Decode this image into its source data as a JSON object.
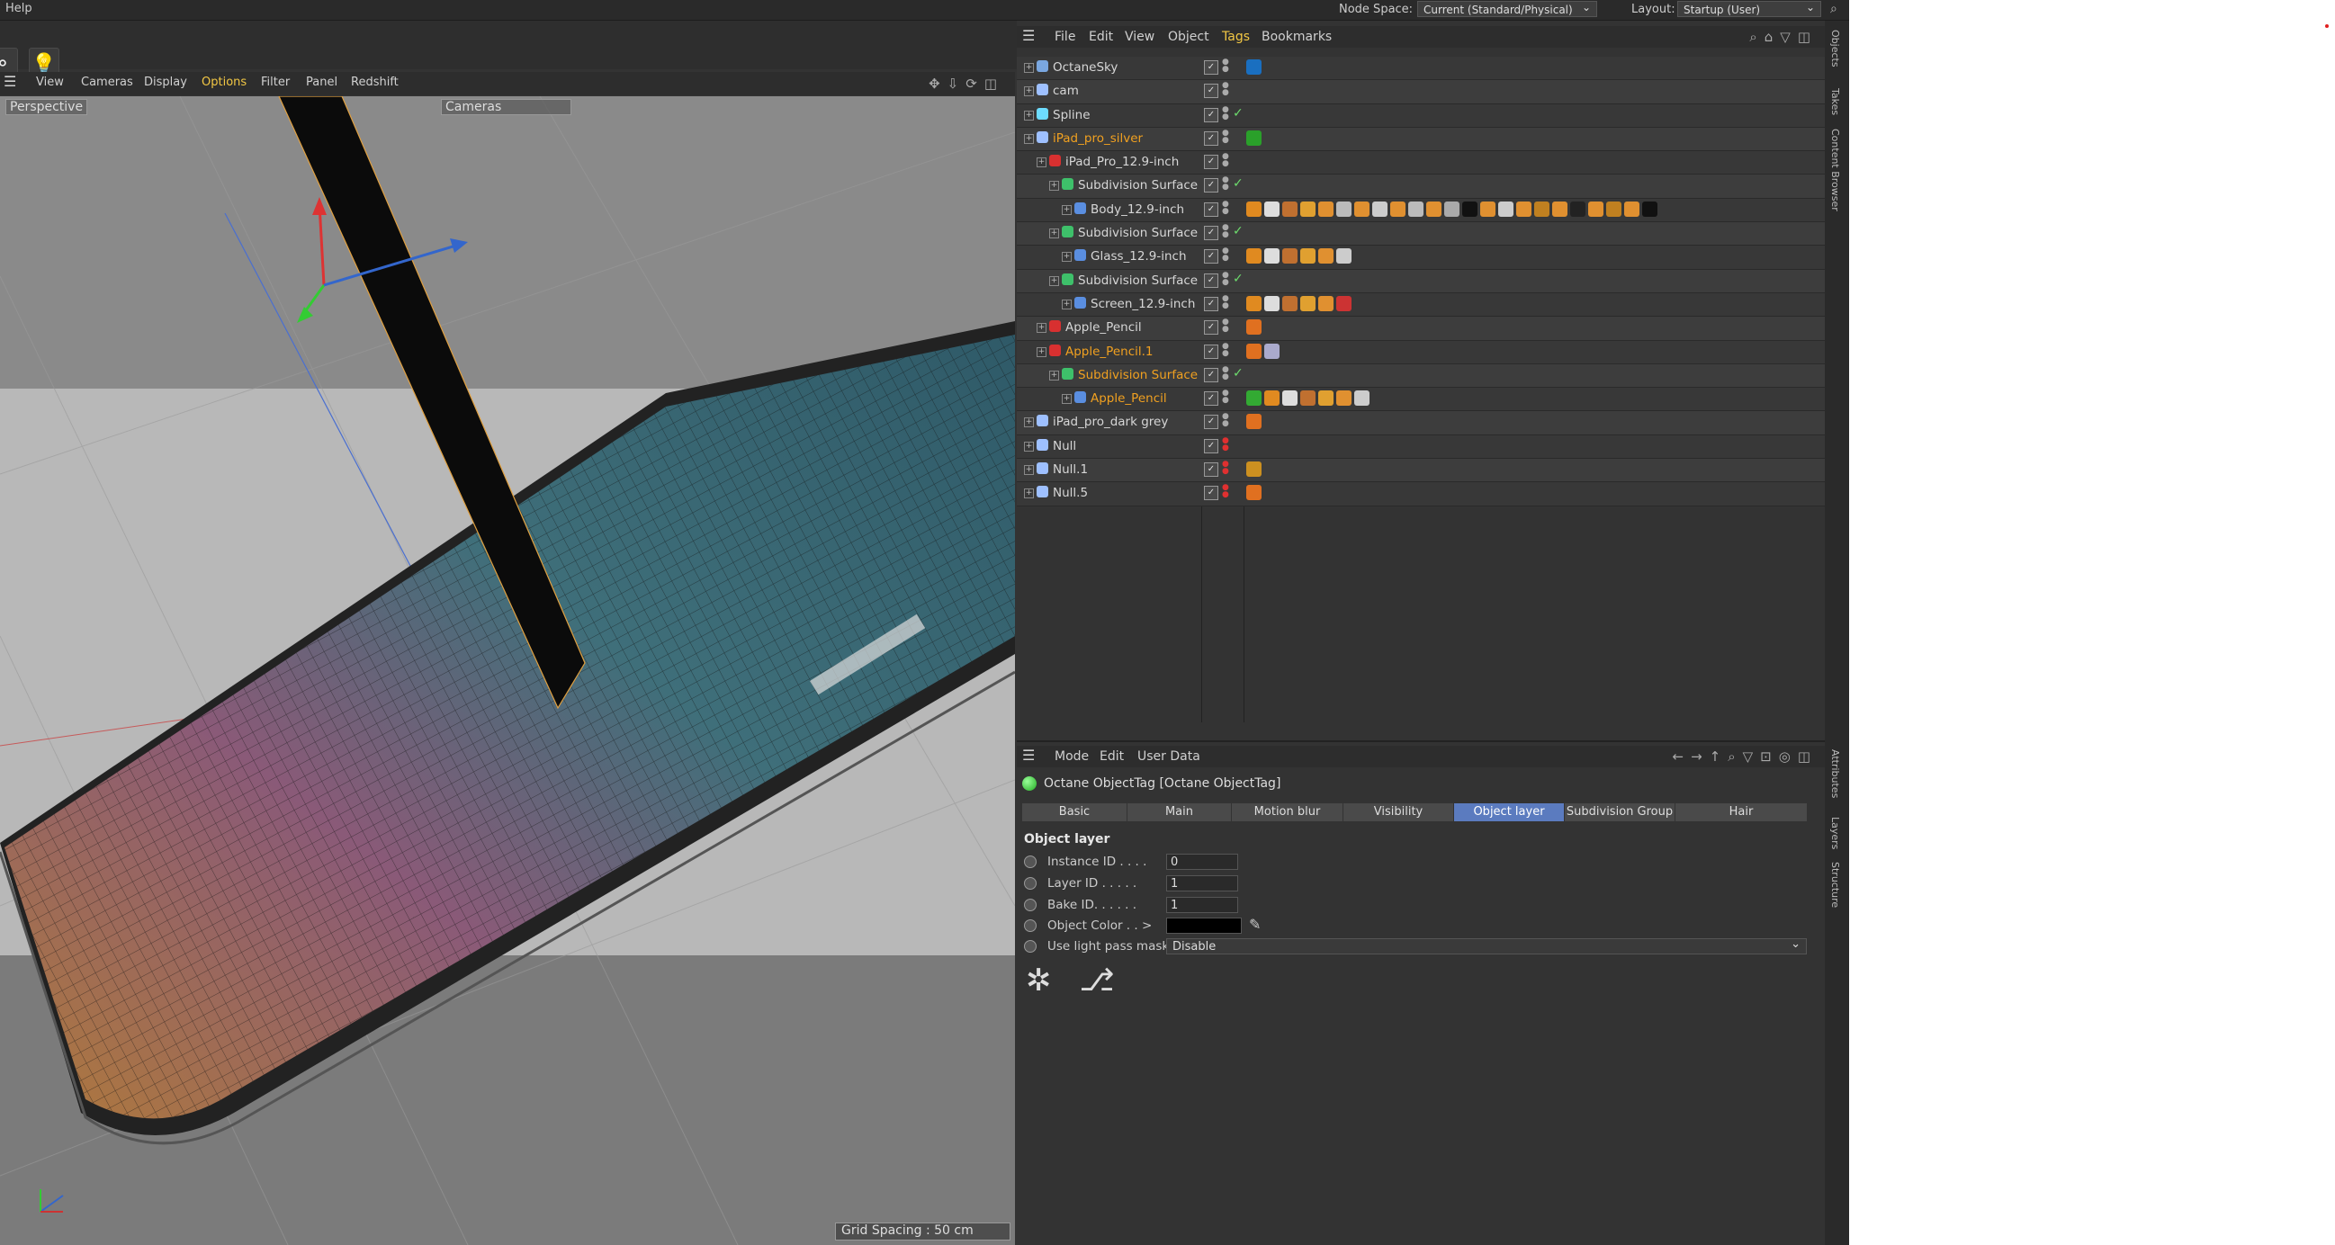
{
  "topbar": {
    "help": "Help",
    "node_space_label": "Node Space:",
    "node_space_value": "Current (Standard/Physical)",
    "layout_label": "Layout:",
    "layout_value": "Startup (User)"
  },
  "viewport": {
    "menu": [
      "View",
      "Cameras",
      "Display",
      "Options",
      "Filter",
      "Panel",
      "Redshift"
    ],
    "view_name": "Perspective",
    "camera": "Cameras",
    "grid_spacing": "Grid Spacing : 50 cm"
  },
  "object_manager": {
    "menu": [
      "File",
      "Edit",
      "View",
      "Object",
      "Tags",
      "Bookmarks"
    ],
    "rows": [
      {
        "name": "OctaneSky",
        "indent": 0
      },
      {
        "name": "cam",
        "indent": 0
      },
      {
        "name": "Spline",
        "indent": 0
      },
      {
        "name": "iPad_pro_silver",
        "indent": 0
      },
      {
        "name": "iPad_Pro_12.9-inch",
        "indent": 1
      },
      {
        "name": "Subdivision Surface",
        "indent": 2
      },
      {
        "name": "Body_12.9-inch",
        "indent": 3
      },
      {
        "name": "Subdivision Surface",
        "indent": 2
      },
      {
        "name": "Glass_12.9-inch",
        "indent": 3
      },
      {
        "name": "Subdivision Surface",
        "indent": 2
      },
      {
        "name": "Screen_12.9-inch",
        "indent": 3
      },
      {
        "name": "Apple_Pencil",
        "indent": 1
      },
      {
        "name": "Apple_Pencil.1",
        "indent": 1
      },
      {
        "name": "Subdivision Surface",
        "indent": 2
      },
      {
        "name": "Apple_Pencil",
        "indent": 3
      },
      {
        "name": "iPad_pro_dark grey",
        "indent": 0
      },
      {
        "name": "Null",
        "indent": 0
      },
      {
        "name": "Null.1",
        "indent": 0
      },
      {
        "name": "Null.5",
        "indent": 0
      }
    ]
  },
  "attributes": {
    "menu": [
      "Mode",
      "Edit",
      "User Data"
    ],
    "title": "Octane ObjectTag [Octane ObjectTag]",
    "tabs": [
      "Basic",
      "Main",
      "Motion blur",
      "Visibility",
      "Object layer",
      "Subdivision Group",
      "Hair"
    ],
    "active_tab": "Object layer",
    "section": "Object layer",
    "props": {
      "instance_id_label": "Instance ID . . . .",
      "instance_id": "0",
      "layer_id_label": "Layer ID . . . . .",
      "layer_id": "1",
      "bake_id_label": "Bake ID. . . . . .",
      "bake_id": "1",
      "object_color_label": "Object Color . . >",
      "use_light_pass_label": "Use light pass mask",
      "use_light_pass": "Disable"
    }
  },
  "side_tabs": [
    "Objects",
    "Takes",
    "Content Browser",
    "Attributes",
    "Layers",
    "Structure"
  ],
  "colors": {
    "accent": "#f2c744",
    "selected_text": "#f0a020",
    "active_tab": "#5b7bbf"
  }
}
